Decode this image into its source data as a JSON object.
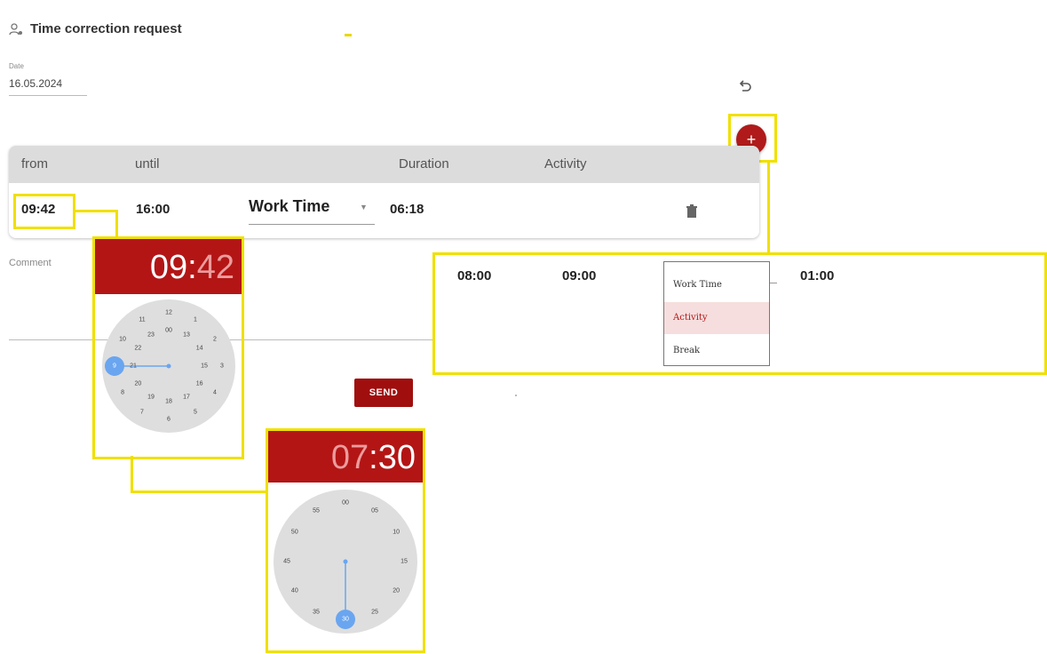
{
  "header": {
    "title": "Time correction request",
    "icon": "person-settings-icon"
  },
  "date": {
    "label": "Date",
    "value": "16.05.2024"
  },
  "table": {
    "columns": [
      "from",
      "until",
      "Duration",
      "Activity"
    ],
    "row": {
      "from": "09:42",
      "until": "16:00",
      "activity": "Work Time",
      "duration": "06:18"
    }
  },
  "comment": {
    "label": "Comment"
  },
  "send_label": "SEND",
  "add_label": "+",
  "colors": {
    "accent": "#b31515",
    "highlight": "#f0e000",
    "header_bg": "#dcdcdc",
    "clock_hand": "#6aa5f0"
  },
  "clock1": {
    "hours": "09",
    "sep": ":",
    "minutes": "42",
    "outer_ticks": [
      "12",
      "1",
      "2",
      "3",
      "4",
      "5",
      "6",
      "7",
      "8",
      "9",
      "10",
      "11"
    ],
    "inner_ticks": [
      "00",
      "13",
      "14",
      "15",
      "16",
      "17",
      "18",
      "19",
      "20",
      "21",
      "22",
      "23"
    ],
    "selected": "9"
  },
  "clock2": {
    "hours": "07",
    "sep": ":",
    "minutes": "30",
    "ticks": [
      "00",
      "05",
      "10",
      "15",
      "20",
      "25",
      "30",
      "35",
      "40",
      "45",
      "50",
      "55"
    ],
    "selected": "30"
  },
  "example_row": {
    "from": "08:00",
    "until": "09:00",
    "duration": "01:00",
    "menu": [
      "Work Time",
      "Activity",
      "Break"
    ],
    "selected_index": 1
  }
}
